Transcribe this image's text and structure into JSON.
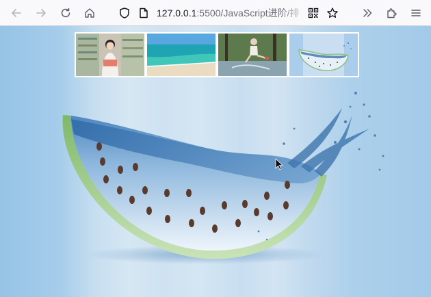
{
  "browser": {
    "url_host": "127.0.0.1",
    "url_path": ":5500/JavaScript进阶/排",
    "icons": {
      "back": "arrow-left-icon",
      "forward": "arrow-right-icon",
      "reload": "reload-icon",
      "home": "home-icon",
      "tracking": "shield-icon",
      "page_info": "page-icon",
      "qr": "qr-code-icon",
      "bookmark": "star-icon",
      "overflow": "chevron-double-right-icon",
      "extensions": "puzzle-icon",
      "menu": "hamburger-menu-icon"
    }
  },
  "gallery": {
    "thumbnails": [
      {
        "subject": "girl-in-library"
      },
      {
        "subject": "tropical-beach"
      },
      {
        "subject": "girl-splashing-water"
      },
      {
        "subject": "watermelon-water"
      }
    ],
    "selected_index": 3
  },
  "hero": {
    "subject": "watermelon-water-splash"
  }
}
